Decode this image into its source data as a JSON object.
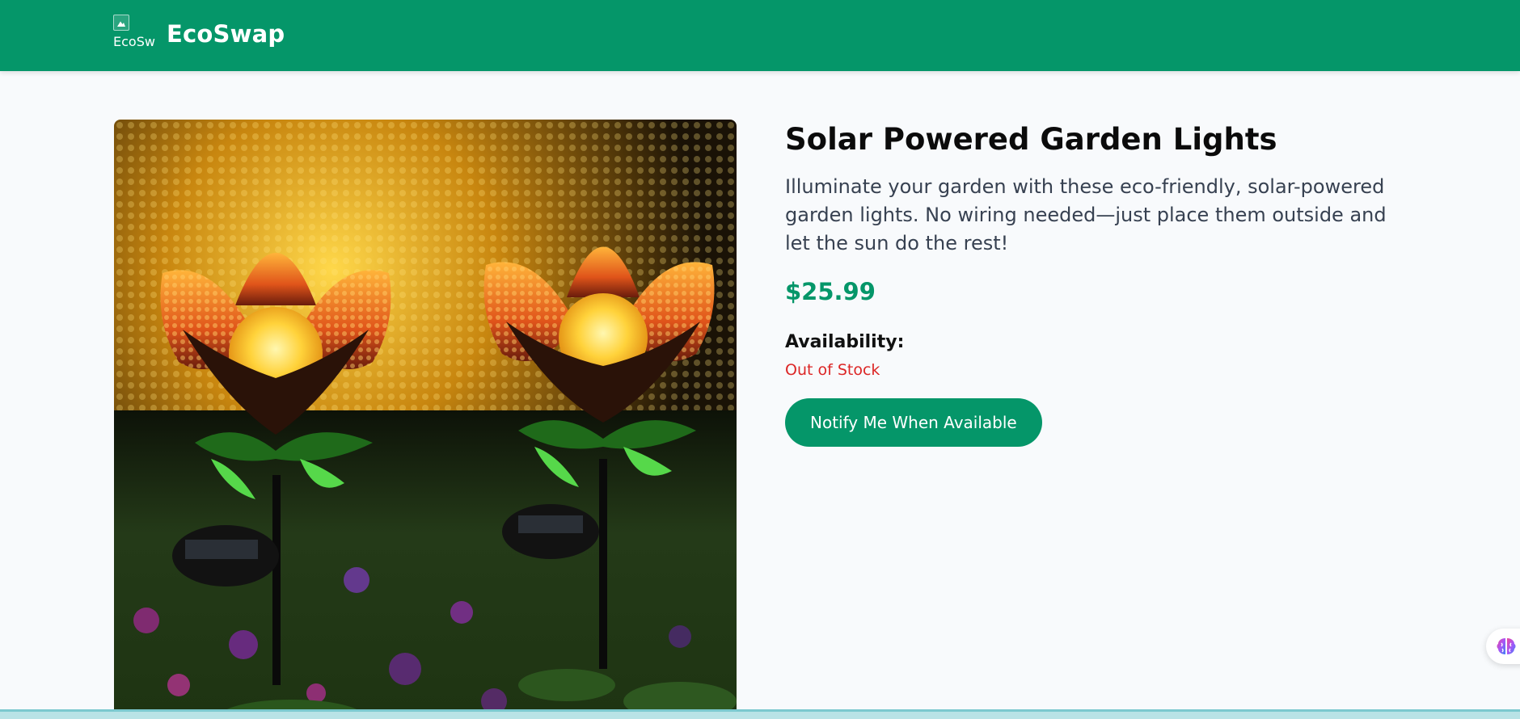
{
  "header": {
    "logo_alt": "EcoSwap",
    "brand_name": "EcoSwap",
    "colors": {
      "bar": "#059669",
      "text": "#ffffff"
    }
  },
  "product": {
    "image_alt": "Solar Powered Garden Lights",
    "title": "Solar Powered Garden Lights",
    "description": "Illuminate your garden with these eco-friendly, solar-powered garden lights. No wiring needed—just place them outside and let the sun do the rest!",
    "price": "$25.99",
    "availability_label": "Availability:",
    "availability_status": "Out of Stock",
    "notify_button_label": "Notify Me When Available",
    "colors": {
      "price": "#059669",
      "status": "#dc2626",
      "button": "#059669"
    }
  },
  "floating_widget": {
    "icon": "brain-icon"
  }
}
